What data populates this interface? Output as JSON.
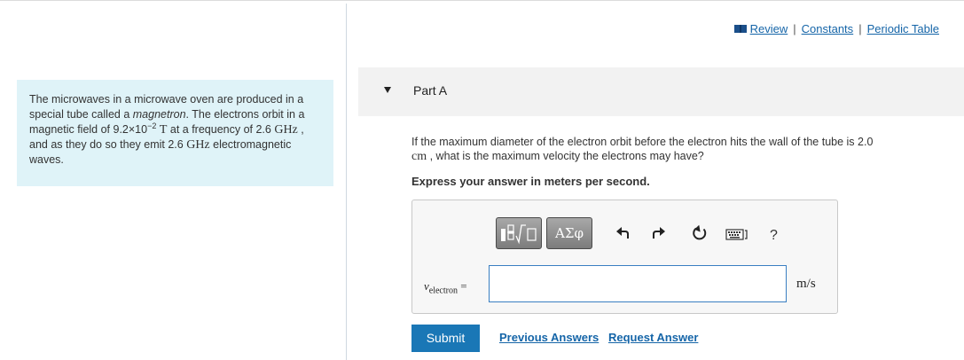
{
  "header_links": {
    "review": "Review",
    "constants": "Constants",
    "periodic_table": "Periodic Table",
    "separator": "|"
  },
  "problem": {
    "p1": "The microwaves in a microwave oven are produced in a special tube called a",
    "magnetron": "magnetron",
    "p2": ". The electrons orbit in a magnetic field of 9.2×10",
    "exp": "−2",
    "unit_t": "T",
    "p3": "at a frequency of 2.6",
    "unit_ghz1": "GHz",
    "p4": ", and as they do so they emit 2.6",
    "unit_ghz2": "GHz",
    "p5": "electromagnetic waves."
  },
  "part": {
    "title": "Part A"
  },
  "question": {
    "text1": "If the maximum diameter of the electron orbit before the electron hits the wall of the tube is 2.0",
    "unit_cm": "cm",
    "text2": ", what is the maximum velocity the electrons may have?"
  },
  "instruction": "Express your answer in meters per second.",
  "toolbar": {
    "symbols_label": "ΑΣφ",
    "help_label": "?"
  },
  "answer": {
    "variable": "v",
    "subscript": "electron",
    "equals": "=",
    "value": "",
    "unit": "m/s"
  },
  "actions": {
    "submit": "Submit",
    "previous_answers": "Previous Answers",
    "request_answer": "Request Answer"
  }
}
